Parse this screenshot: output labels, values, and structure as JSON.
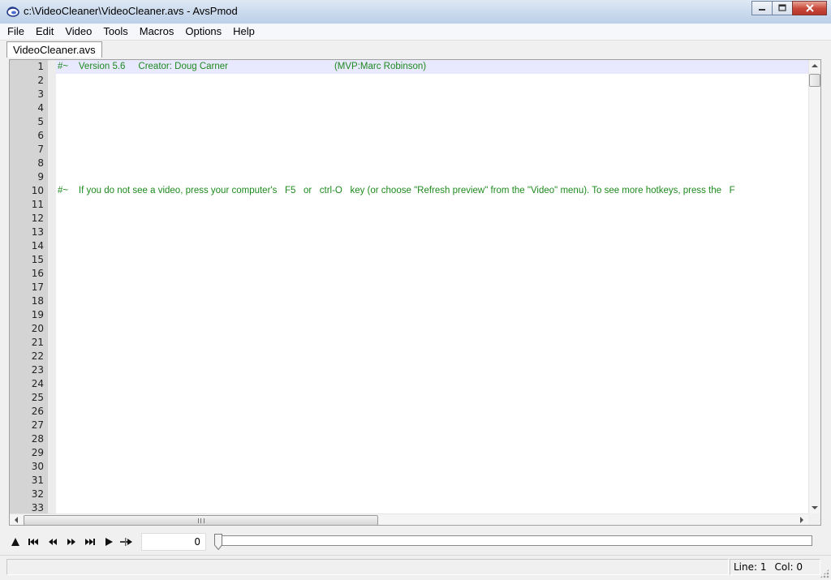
{
  "window": {
    "title": "c:\\VideoCleaner\\VideoCleaner.avs - AvsPmod",
    "app_icon": "avspmod-icon",
    "buttons": [
      "minimize-icon",
      "maximize-icon",
      "close-icon"
    ]
  },
  "menu": [
    "File",
    "Edit",
    "Video",
    "Tools",
    "Macros",
    "Options",
    "Help"
  ],
  "tabs": [
    {
      "label": "VideoCleaner.avs",
      "active": true
    }
  ],
  "editor": {
    "line_count": 33,
    "current_line": 1,
    "code_color": "#1d8a1d",
    "current_line_color": "#e8e8ff",
    "lines": {
      "1": "#~    Version 5.6     Creator: Doug Carner                                         (MVP:Marc Robinson)",
      "10": "#~    If you do not see a video, press your computer's   F5   or   ctrl-O   key (or choose \"Refresh preview\" from the \"Video\" menu). To see more hotkeys, press the   F"
    }
  },
  "toolbar": {
    "buttons": [
      "toggle-preview-icon",
      "first-frame-icon",
      "prev-frame-icon",
      "next-frame-icon",
      "last-frame-icon",
      "play-icon",
      "jump-icon"
    ],
    "frame_value": "0",
    "slider_position": 0
  },
  "status": {
    "left": "",
    "line": "Line: 1",
    "col": "Col: 0"
  }
}
